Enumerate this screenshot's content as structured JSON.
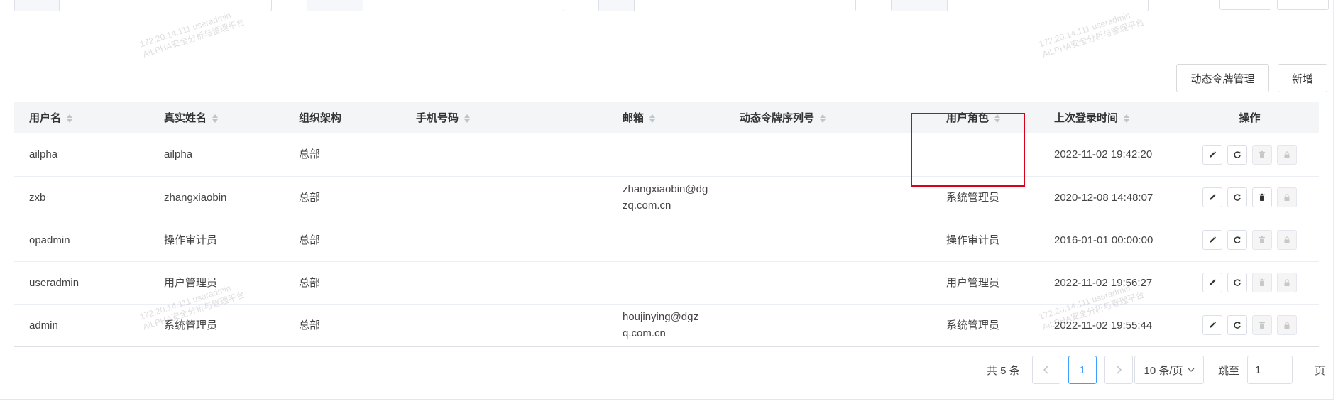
{
  "toolbar": {
    "token_mgmt_label": "动态令牌管理",
    "add_label": "新增"
  },
  "table": {
    "columns": [
      {
        "label": "用户名",
        "sortable": true
      },
      {
        "label": "真实姓名",
        "sortable": true
      },
      {
        "label": "组织架构",
        "sortable": false
      },
      {
        "label": "手机号码",
        "sortable": true
      },
      {
        "label": "邮箱",
        "sortable": true
      },
      {
        "label": "动态令牌序列号",
        "sortable": true
      },
      {
        "label": "用户角色",
        "sortable": true
      },
      {
        "label": "上次登录时间",
        "sortable": true
      },
      {
        "label": "操作",
        "sortable": false
      }
    ],
    "rows": [
      {
        "username": "ailpha",
        "realname": "ailpha",
        "org": "总部",
        "phone": "",
        "email": "",
        "token": "",
        "role": "",
        "last_login": "2022-11-02 19:42:20",
        "can_delete": false
      },
      {
        "username": "zxb",
        "realname": "zhangxiaobin",
        "org": "总部",
        "phone": "",
        "email": "zhangxiaobin@dgzq.com.cn",
        "token": "",
        "role": "系统管理员",
        "last_login": "2020-12-08 14:48:07",
        "can_delete": true
      },
      {
        "username": "opadmin",
        "realname": "操作审计员",
        "org": "总部",
        "phone": "",
        "email": "",
        "token": "",
        "role": "操作审计员",
        "last_login": "2016-01-01 00:00:00",
        "can_delete": false
      },
      {
        "username": "useradmin",
        "realname": "用户管理员",
        "org": "总部",
        "phone": "",
        "email": "",
        "token": "",
        "role": "用户管理员",
        "last_login": "2022-11-02 19:56:27",
        "can_delete": false
      },
      {
        "username": "admin",
        "realname": "系统管理员",
        "org": "总部",
        "phone": "",
        "email": "houjinying@dgzq.com.cn",
        "token": "",
        "role": "系统管理员",
        "last_login": "2022-11-02 19:55:44",
        "can_delete": false
      }
    ],
    "action_icons": [
      "edit-icon",
      "reset-icon",
      "delete-icon",
      "lock-icon"
    ]
  },
  "pagination": {
    "total_text": "共 5 条",
    "prev_icon": "chevron-left-icon",
    "next_icon": "chevron-right-icon",
    "current_page": "1",
    "page_size": "10 条/页",
    "jump_label": "跳至",
    "jump_value": "1",
    "page_suffix": "页"
  },
  "watermark": {
    "line1": "172.20.14.111  useradmin",
    "line2": "AiLPHA安全分析与管理平台"
  },
  "colors": {
    "accent": "#409eff",
    "highlight_border": "#d9001b",
    "header_bg": "#f4f5f7"
  }
}
